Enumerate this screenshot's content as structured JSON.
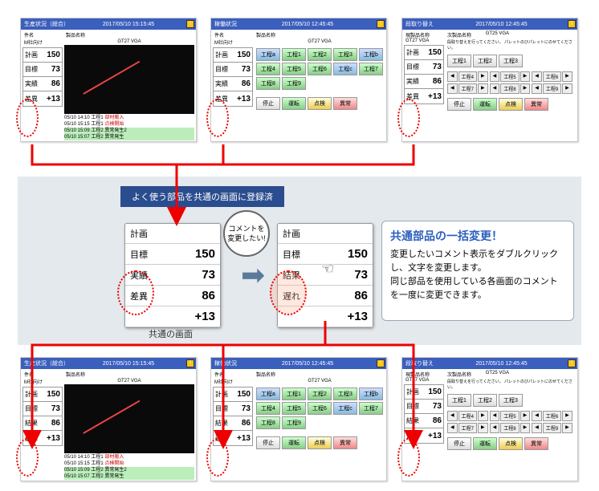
{
  "timestamps": {
    "t1": "2017/05/10 15:15:45",
    "t2": "2017/05/10 12:45:45",
    "t3": "2017/05/10 12:45:45"
  },
  "top": {
    "p1": {
      "title": "生産状況（総合）",
      "sub1": "件名",
      "sub2": "M社向け",
      "prod_l": "製品名称",
      "prod": "GT27 VGA"
    },
    "p2": {
      "title": "稼働状況",
      "sub1": "件名",
      "sub2": "M社向け",
      "prod_l": "製品名称",
      "prod": "GT27 VGA"
    },
    "p3": {
      "title": "段取り替え",
      "sub1": "現製品名称",
      "sub2": "GT27 VGA",
      "prod_l": "次製品名称",
      "prod": "GT25 VGA",
      "msg": "段取り替えを行ってください。\nパレットのびパレットにのせてください。"
    }
  },
  "labels_before": [
    "計画",
    "目標",
    "実績",
    "差異"
  ],
  "labels_after": [
    "計画",
    "目標",
    "結果",
    "遅れ"
  ],
  "vals": [
    "",
    "150",
    "73",
    "86",
    "+13"
  ],
  "vals2": [
    "150",
    "73",
    "86",
    "+13"
  ],
  "log": [
    {
      "t": "05/10 14:10 工程1",
      "e": "部材搬入",
      "c": "r"
    },
    {
      "t": "05/10 15:15 工程1",
      "e": "点検開始",
      "c": "r"
    },
    {
      "t": "05/10 15:09 工程2",
      "e": "異常発生2",
      "c": "g"
    },
    {
      "t": "05/10 15:07 工程2",
      "e": "異常発生",
      "c": "g"
    }
  ],
  "proc_btns": [
    "工程a",
    "工程1",
    "工程2",
    "工程3",
    "工程b",
    "工程4",
    "工程5",
    "工程6",
    "工程c",
    "工程7",
    "工程8",
    "工程9"
  ],
  "ctrl_btns": [
    {
      "l": "停止",
      "c": ""
    },
    {
      "l": "運転",
      "c": "grn"
    },
    {
      "l": "点検",
      "c": "yel"
    },
    {
      "l": "異常",
      "c": "red"
    }
  ],
  "proc_btns3": [
    "工程1",
    "工程2",
    "工程3",
    "工程4",
    "工程5",
    "工程6",
    "工程7",
    "工程8",
    "工程9"
  ],
  "banner": "よく使う部品を共通の画面に登録済",
  "bubble": "コメントを\n変更したい!",
  "caption": "共通の画面",
  "info": {
    "title": "共通部品の一括変更！",
    "l1": "変更したいコメント表示をダブルクリック",
    "l2": "し、文字を変更します。",
    "l3": "同じ部品を使用している各画面のコメント",
    "l4": "を一度に変更できます。"
  }
}
